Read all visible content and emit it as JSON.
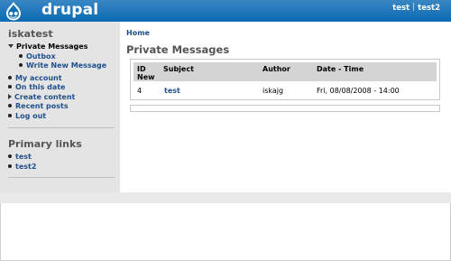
{
  "site": {
    "name": "drupal",
    "logo_icon": "drupal-drop-icon"
  },
  "header": {
    "links": [
      "test",
      "test2"
    ]
  },
  "sidebar": {
    "user_block_title": "iskatest",
    "menu": {
      "private_messages": "Private Messages",
      "outbox": "Outbox",
      "write_new_message": "Write New Message",
      "my_account": "My account",
      "on_this_date": "On this date",
      "create_content": "Create content",
      "recent_posts": "Recent posts",
      "log_out": "Log out"
    },
    "primary_links_title": "Primary links",
    "primary_links": [
      "test",
      "test2"
    ]
  },
  "main": {
    "breadcrumb": "Home",
    "page_title": "Private Messages",
    "table": {
      "headers": {
        "id_new_1": "ID",
        "id_new_2": "New",
        "subject": "Subject",
        "author": "Author",
        "datetime": "Date - Time"
      },
      "rows": [
        {
          "id": "4",
          "subject": "test",
          "author": "iskajg",
          "datetime": "Fri, 08/08/2008 - 14:00"
        }
      ]
    }
  },
  "colors": {
    "header_blue": "#0e6fb5",
    "link_blue": "#1f4f8c",
    "sidebar_bg": "#e4e4e4"
  }
}
